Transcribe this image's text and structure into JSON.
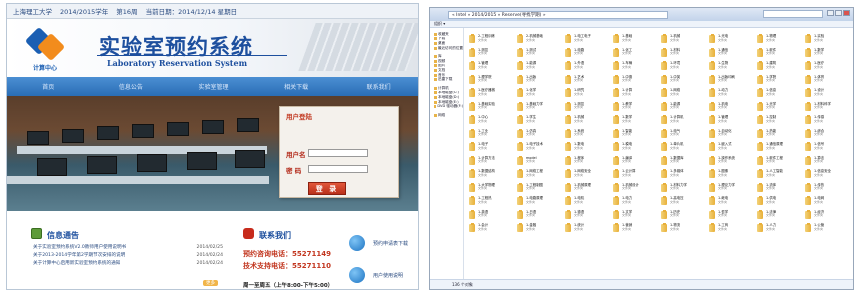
{
  "lab": {
    "topbar": {
      "school": "上海理工大学",
      "term": "2014/2015学年",
      "week": "第16周",
      "date": "当前日期：2014/12/14 星期日"
    },
    "logo_text": "计算中心",
    "title_cn": "实验室预约系统",
    "title_en": "Laboratory Reservation System",
    "nav": [
      "首页",
      "信息公告",
      "实验室管理",
      "相关下载",
      "联系我们"
    ],
    "login": {
      "header": "用户登陆",
      "user_label": "用户名",
      "pass_label": "密 码",
      "button": "登 录"
    },
    "notice": {
      "title": "信息通告",
      "rows": [
        {
          "t": "关于实验室预约系统V2.0教师用户使用说明书",
          "d": "2014/02/25"
        },
        {
          "t": "关于2013-2014学年第2学期节次安排的说明",
          "d": "2014/02/24"
        },
        {
          "t": "关于计算中心启用新实验室预约系统的通知",
          "d": "2014/02/24"
        }
      ],
      "more": "更多"
    },
    "contact": {
      "title": "联系我们",
      "phone1": "预约咨询电话：55271149",
      "phone2": "技术支持电话：55271110",
      "hours": "周一至周五（上午8:00-下午5:00）"
    },
    "side": {
      "download": "预约申请表下载",
      "manual": "用户使用说明"
    }
  },
  "explorer": {
    "path": "« Intel » 2014/2015 » Reserve(寻找学期) »",
    "toolbar": "组织 ▾",
    "nav": [
      "收藏夹",
      "下载",
      "桌面",
      "最近访问的位置",
      "",
      "库",
      "视频",
      "图片",
      "文档",
      "音乐",
      "迅雷下载",
      "",
      "计算机",
      "本地磁盘(C:)",
      "本地磁盘(D:)",
      "本地磁盘(E:)",
      "DVD 驱动器(F:)",
      "",
      "网络"
    ],
    "folders": [
      "2-工程训练",
      "2-机械基础",
      "1-电工电子",
      "1-基础",
      "1-机械",
      "1-光电",
      "1-物理",
      "1-实验",
      "1-测控",
      "1-测试",
      "1-电路",
      "1-化工",
      "1-材料",
      "1-通信",
      "1-软件",
      "1-数学",
      "1-管理",
      "1-能源",
      "1-外语",
      "1-车辆",
      "1-环境",
      "1-生物",
      "1-建筑",
      "1-医疗",
      "1-理学院",
      "1-出版",
      "1-艺术",
      "1-中德",
      "1-中英",
      "1-出版印刷",
      "1-学院",
      "1-体育",
      "1-医疗器械",
      "1-化学",
      "1-研究",
      "1-计算",
      "1-网络",
      "1-动力",
      "1-信息",
      "1-设计",
      "1-基础实验",
      "1-基础力学",
      "1-测控",
      "1-教学",
      "1-能源",
      "1-机电",
      "1-光学",
      "1-材料科学",
      "1-中心",
      "1-学生",
      "1-机械",
      "1-数学",
      "1-计算机",
      "1-管理",
      "1-控制",
      "1-传感",
      "1-工业",
      "1-仿真",
      "1-系统",
      "1-智能",
      "1-电气",
      "1-自动化",
      "1-热能",
      "1-综合",
      "1-电子",
      "1-电子技术",
      "1-数电",
      "1-模电",
      "1-单片机",
      "1-嵌入式",
      "1-通信原理",
      "1-信号",
      "1-计算方法",
      "model",
      "1-程序",
      "1-编译",
      "1-数据库",
      "1-操作系统",
      "1-软件工程",
      "1-算法",
      "1-数据结构",
      "1-网络工程",
      "1-网络安全",
      "1-云计算",
      "1-多媒体",
      "1-图像",
      "1-人工智能",
      "1-信息安全",
      "1-大学物理",
      "1-工程制图",
      "1-机械原理",
      "1-机械设计",
      "1-材料力学",
      "1-理论力学",
      "1-流体",
      "1-传热",
      "1-工程热",
      "1-电路原理",
      "1-电机",
      "1-电力",
      "1-高电压",
      "1-继电",
      "1-供电",
      "1-电网",
      "1-英语",
      "1-日语",
      "1-德语",
      "1-文学",
      "1-历史",
      "1-哲学",
      "1-法律",
      "1-经济",
      "1-会计",
      "1-金融",
      "1-统计",
      "1-营销",
      "1-物流",
      "1-工商",
      "1-人力",
      "1-公管"
    ],
    "folder_sub": "文件夹",
    "status": "136 个对象"
  }
}
